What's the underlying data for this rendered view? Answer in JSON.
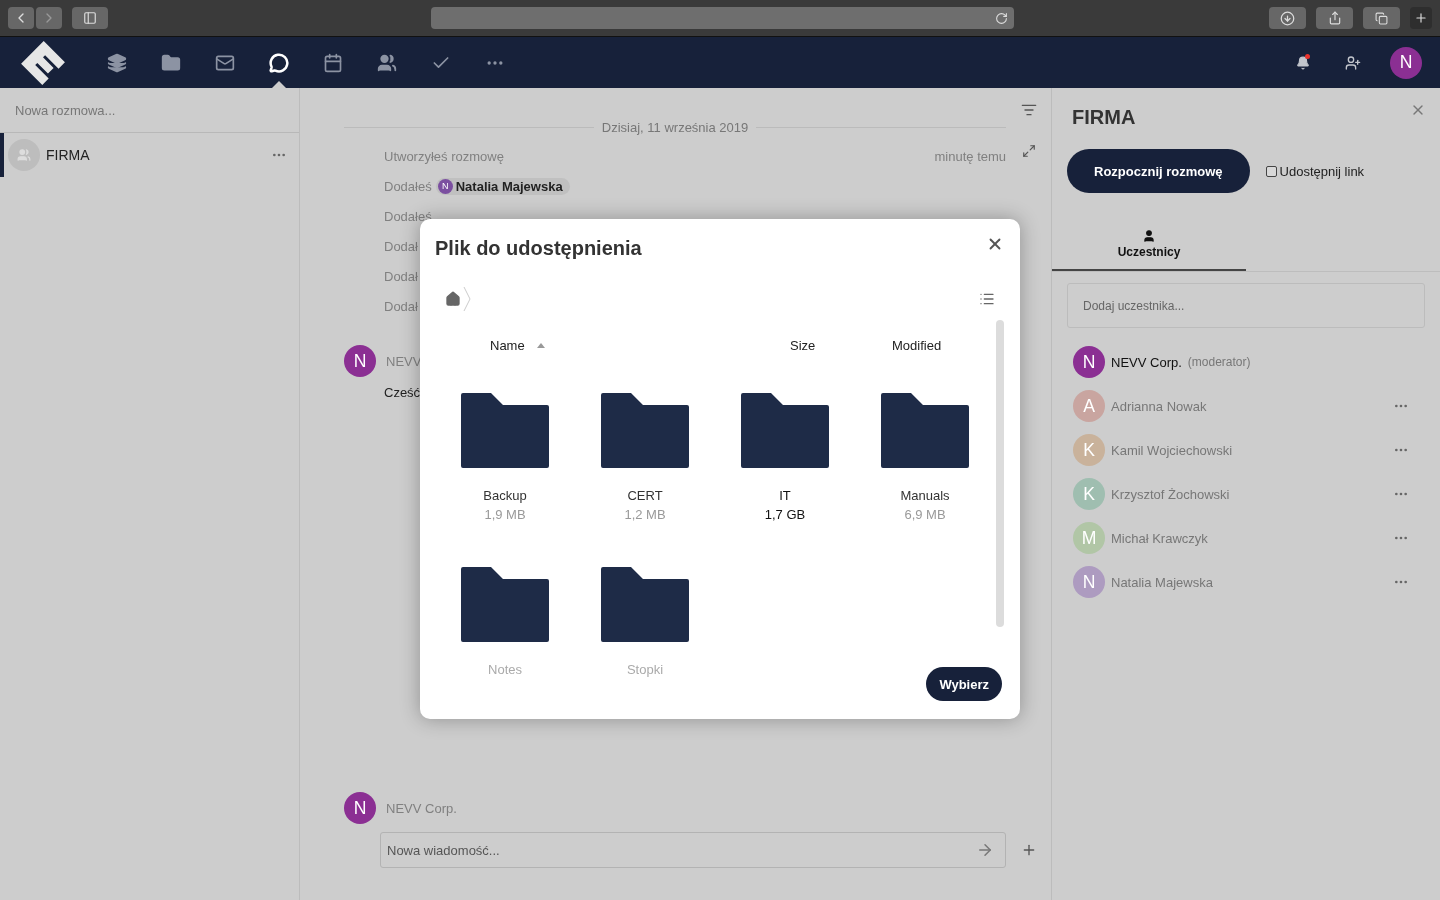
{
  "nav": {
    "apps": [
      {
        "kind": "deck",
        "selected": false
      },
      {
        "kind": "files",
        "selected": false
      },
      {
        "kind": "mail",
        "selected": false
      },
      {
        "kind": "talk",
        "selected": true
      },
      {
        "kind": "calendar",
        "selected": false
      },
      {
        "kind": "contacts",
        "selected": false
      },
      {
        "kind": "tasks",
        "selected": false
      },
      {
        "kind": "more",
        "selected": false
      }
    ],
    "notifications_unread": true,
    "avatar": "N"
  },
  "sidebar": {
    "placeholder": "Nowa rozmowa...",
    "conversations": [
      {
        "name": "FIRMA",
        "selected": true
      }
    ]
  },
  "chat": {
    "date": "Dzisiaj, 11 września 2019",
    "events": [
      {
        "text": "Utworzyłeś rozmowę",
        "time": "minutę temu"
      },
      {
        "text": "Dodałeś",
        "chip": {
          "initial": "N",
          "name": "Natalia Majewska",
          "color": "#7b4fa0"
        }
      },
      {
        "text": "Dodałeś"
      },
      {
        "text": "Dodał"
      },
      {
        "text": "Dodał"
      },
      {
        "text": "Dodał"
      }
    ],
    "message": {
      "avatar": "N",
      "author": "NEVV",
      "text": "Cześć"
    },
    "composer": {
      "avatar": "N",
      "author": "NEVV Corp.",
      "placeholder": "Nowa wiadomość..."
    }
  },
  "dialog": {
    "title": "Plik do udostępnienia",
    "columns": [
      {
        "label": "Name",
        "sorted": true
      },
      {
        "label": "Size",
        "sorted": false
      },
      {
        "label": "Modified",
        "sorted": false
      }
    ],
    "files": [
      {
        "name": "Backup",
        "size": "1,9 MB",
        "disabled": false,
        "hovered": false
      },
      {
        "name": "CERT",
        "size": "1,2 MB",
        "disabled": false,
        "hovered": false
      },
      {
        "name": "IT",
        "size": "1,7 GB",
        "disabled": false,
        "hovered": true
      },
      {
        "name": "Manuals",
        "size": "6,9 MB",
        "disabled": false,
        "hovered": false
      },
      {
        "name": "Notes",
        "disabled": true,
        "hovered": false
      },
      {
        "name": "Stopki",
        "disabled": true,
        "hovered": false
      }
    ],
    "button": "Wybierz"
  },
  "details": {
    "title": "FIRMA",
    "start_button": "Rozpocznij rozmowę",
    "share_link": {
      "label": "Udostępnij link",
      "checked": false
    },
    "tabs": [
      {
        "label": "Uczestnicy",
        "selected": true
      }
    ],
    "placeholder": "Dodaj uczestnika...",
    "participants": [
      {
        "initial": "N",
        "name": "NEVV Corp.",
        "role": "(moderator)",
        "color": "#8b2f93",
        "offline": false,
        "menu": false
      },
      {
        "initial": "A",
        "name": "Adrianna Nowak",
        "color": "#c9a5a0",
        "offline": true,
        "menu": true
      },
      {
        "initial": "K",
        "name": "Kamil Wojciechowski",
        "color": "#c9b29b",
        "offline": true,
        "menu": true
      },
      {
        "initial": "K",
        "name": "Krzysztof Żochowski",
        "color": "#9fbeb0",
        "offline": true,
        "menu": true
      },
      {
        "initial": "M",
        "name": "Michał Krawczyk",
        "color": "#b1c6a6",
        "offline": true,
        "menu": true
      },
      {
        "initial": "N",
        "name": "Natalia Majewska",
        "color": "#ad9bc0",
        "offline": true,
        "menu": true
      }
    ]
  }
}
